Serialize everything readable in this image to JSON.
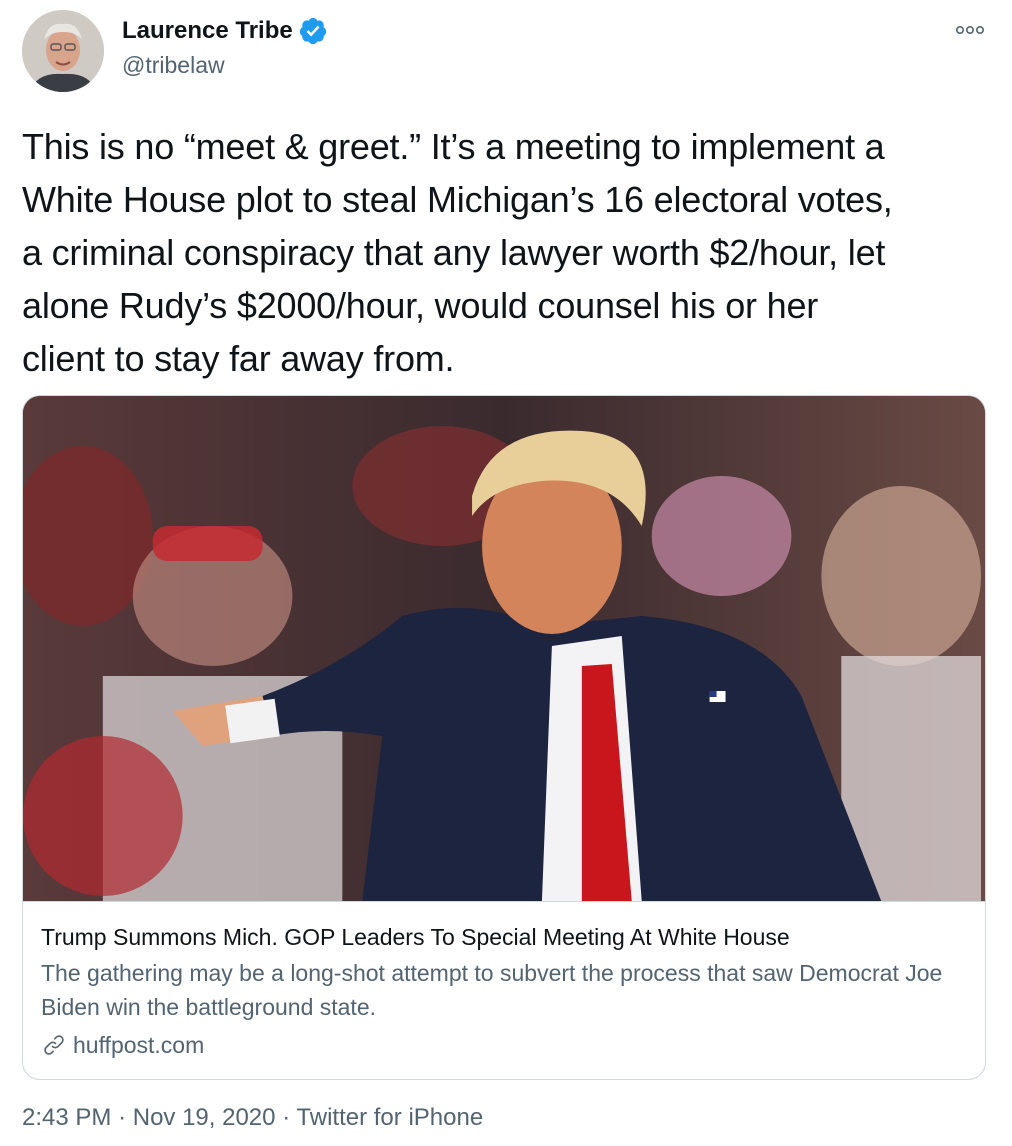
{
  "author": {
    "display_name": "Laurence Tribe",
    "handle": "@tribelaw",
    "verified_icon": "verified-badge-icon",
    "avatar_icon": "profile-photo"
  },
  "more_icon": "more-options-icon",
  "tweet": {
    "text": "This is no “meet & greet.” It’s a meeting to implement a\nWhite House plot to steal Michigan’s 16 electoral votes,\na criminal conspiracy that any lawyer worth $2/hour, let\nalone Rudy’s $2000/hour, would counsel his or her\nclient to stay far away from."
  },
  "card": {
    "image_icon": "news-photo",
    "title": "Trump Summons Mich. GOP Leaders To Special Meeting At White House",
    "description": "The gathering may be a long-shot attempt to subvert the process that saw Democrat Joe Biden win the battleground state.",
    "domain": "huffpost.com",
    "link_icon": "link-icon"
  },
  "meta": {
    "time": "2:43 PM",
    "separator": "·",
    "date": "Nov 19, 2020",
    "source": "Twitter for iPhone"
  },
  "colors": {
    "verified_blue": "#1d9bf0",
    "secondary_text": "#536471",
    "border": "#cfd9de"
  }
}
